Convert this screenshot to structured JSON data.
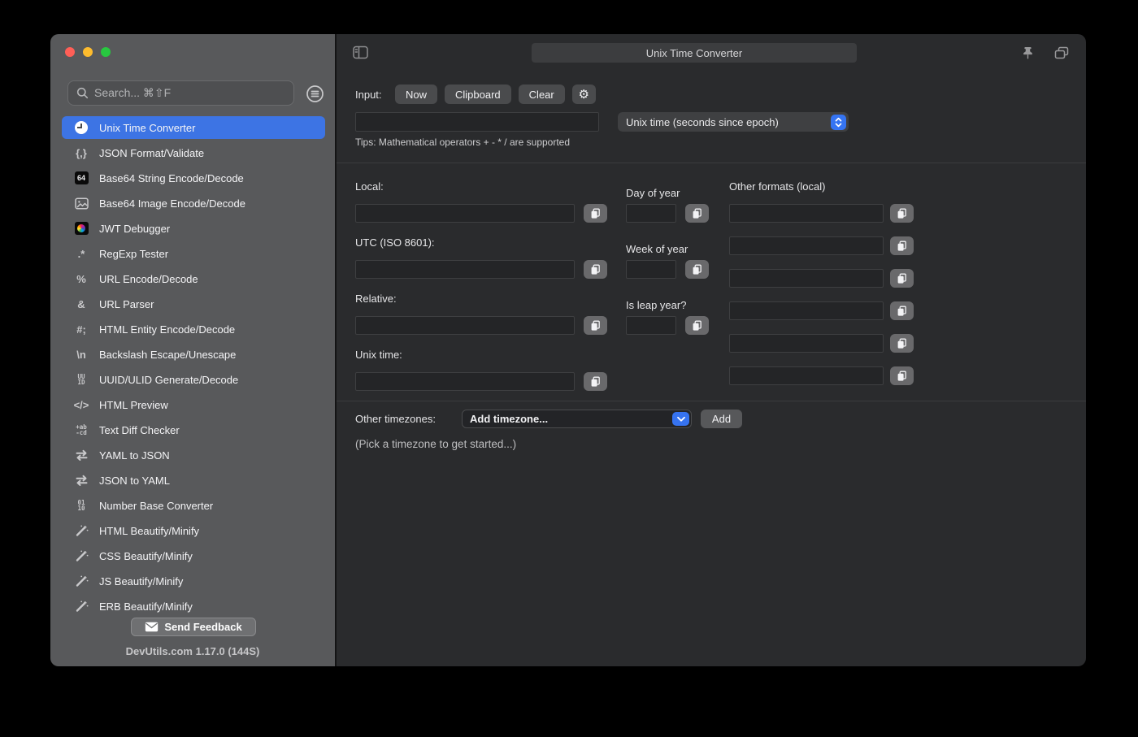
{
  "titlebar": {
    "title": "Unix Time Converter"
  },
  "sidebar": {
    "search_placeholder": "Search... ⌘⇧F",
    "items": [
      {
        "label": "Unix Time Converter",
        "icon": "clock",
        "selected": true
      },
      {
        "label": "JSON Format/Validate",
        "icon": "braces",
        "glyph": "{,}"
      },
      {
        "label": "Base64 String Encode/Decode",
        "icon": "badge64",
        "glyph": "64"
      },
      {
        "label": "Base64 Image Encode/Decode",
        "icon": "image"
      },
      {
        "label": "JWT Debugger",
        "icon": "jwt"
      },
      {
        "label": "RegExp Tester",
        "icon": "regex",
        "glyph": ".*"
      },
      {
        "label": "URL Encode/Decode",
        "icon": "percent",
        "glyph": "%"
      },
      {
        "label": "URL Parser",
        "icon": "ampersand",
        "glyph": "&"
      },
      {
        "label": "HTML Entity Encode/Decode",
        "icon": "entity",
        "glyph": "#;"
      },
      {
        "label": "Backslash Escape/Unescape",
        "icon": "backslash",
        "glyph": "\\n"
      },
      {
        "label": "UUID/ULID Generate/Decode",
        "icon": "uuid",
        "glyph2": "UU\nID"
      },
      {
        "label": "HTML Preview",
        "icon": "code",
        "glyph": "</>"
      },
      {
        "label": "Text Diff Checker",
        "icon": "diff",
        "glyph2": "+ab\n-cd"
      },
      {
        "label": "YAML to JSON",
        "icon": "swap"
      },
      {
        "label": "JSON to YAML",
        "icon": "swap"
      },
      {
        "label": "Number Base Converter",
        "icon": "numbase",
        "glyph2": "01\n10"
      },
      {
        "label": "HTML Beautify/Minify",
        "icon": "wand"
      },
      {
        "label": "CSS Beautify/Minify",
        "icon": "wand"
      },
      {
        "label": "JS Beautify/Minify",
        "icon": "wand"
      },
      {
        "label": "ERB Beautify/Minify",
        "icon": "wand"
      }
    ],
    "feedback_label": "Send Feedback",
    "version": "DevUtils.com 1.17.0 (144S)"
  },
  "input_section": {
    "label": "Input:",
    "now_button": "Now",
    "clipboard_button": "Clipboard",
    "clear_button": "Clear",
    "input_value": "",
    "format_select_value": "Unix time (seconds since epoch)",
    "tips": "Tips: Mathematical operators + - * / are supported"
  },
  "converter": {
    "left_fields": [
      {
        "label": "Local:",
        "value": ""
      },
      {
        "label": "UTC (ISO 8601):",
        "value": ""
      },
      {
        "label": "Relative:",
        "value": ""
      },
      {
        "label": "Unix time:",
        "value": ""
      }
    ],
    "middle_fields": [
      {
        "label": "Day of year",
        "value": ""
      },
      {
        "label": "Week of year",
        "value": ""
      },
      {
        "label": "Is leap year?",
        "value": ""
      }
    ],
    "other_formats": {
      "header": "Other formats (local)",
      "values": [
        "",
        "",
        "",
        "",
        "",
        ""
      ]
    }
  },
  "timezones": {
    "label": "Other timezones:",
    "combobox_value": "Add timezone...",
    "add_button": "Add",
    "hint": "(Pick a timezone to get started...)"
  },
  "colors": {
    "accent_blue": "#3D74E4",
    "stepper_blue": "#3574F2",
    "sidebar_gray": "#58595B",
    "content_bg": "#2A2B2D"
  }
}
